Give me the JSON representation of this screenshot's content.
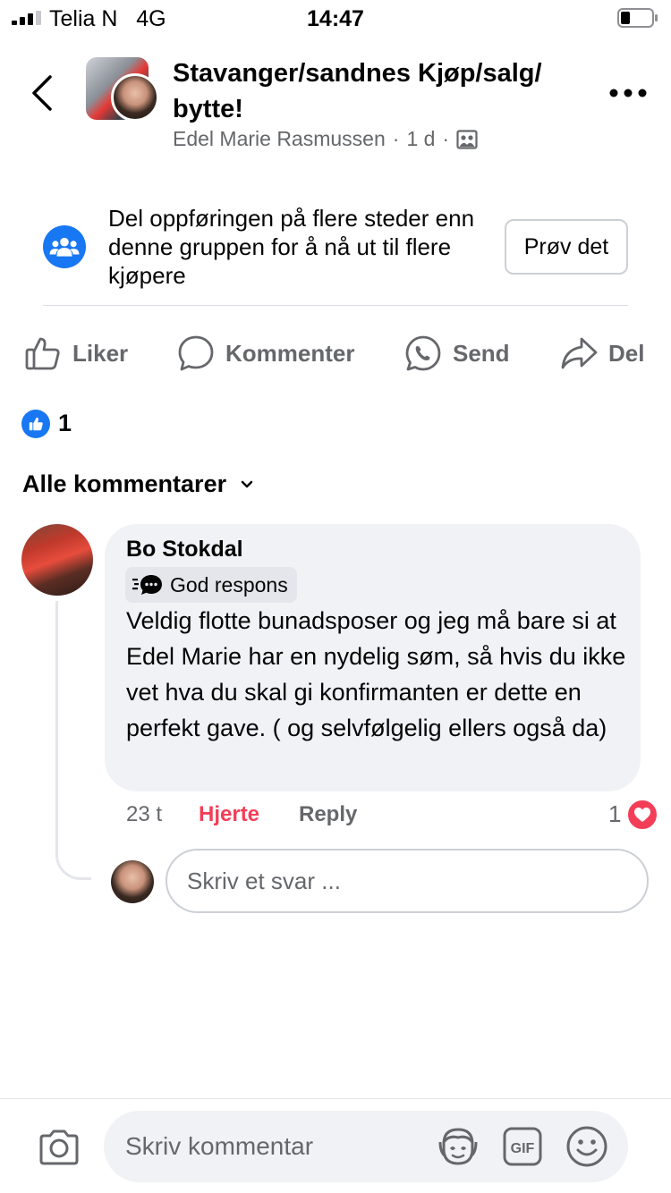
{
  "status_bar": {
    "carrier": "Telia N",
    "network": "4G",
    "time": "14:47",
    "signal_bars_filled": 3,
    "signal_bars_total": 4
  },
  "header": {
    "group_title": "Stavanger/sandnes Kjøp/salg/ bytte!",
    "author_name": "Edel Marie Rasmussen",
    "separator": "·",
    "post_age": "1 d",
    "audience_icon": "group-members-icon",
    "back_icon": "chevron-left-icon",
    "more_icon": "more-dots-icon"
  },
  "share_prompt": {
    "icon": "group-people-icon",
    "text": "Del oppføringen på flere steder enn denne gruppen for å nå ut til flere kjøpere",
    "button_label": "Prøv det"
  },
  "actions": {
    "like": {
      "label": "Liker",
      "icon": "thumbs-up-outline-icon"
    },
    "comment": {
      "label": "Kommenter",
      "icon": "comment-bubble-icon"
    },
    "send": {
      "label": "Send",
      "icon": "whatsapp-icon"
    },
    "share": {
      "label": "Del",
      "icon": "share-arrow-icon"
    }
  },
  "reactions": {
    "icon": "like-reaction-icon",
    "count": "1"
  },
  "comments_filter": {
    "label": "Alle kommentarer",
    "icon": "chevron-down-icon"
  },
  "comment": {
    "author": "Bo Stokdal",
    "badge": {
      "label": "God respons",
      "icon": "fast-responder-icon"
    },
    "text": "Veldig flotte bunadsposer og jeg må bare si at Edel Marie har en nydelig søm, så hvis du ikke vet hva du skal gi konfirmanten er dette en perfekt gave. ( og selvfølgelig ellers også da)",
    "time": "23 t",
    "reaction_label": "Hjerte",
    "reply_label": "Reply",
    "reaction_count": "1",
    "reaction_icon": "heart-reaction-icon"
  },
  "reply": {
    "placeholder": "Skriv et svar ..."
  },
  "composer": {
    "placeholder": "Skriv kommentar",
    "camera_icon": "camera-icon",
    "avatar_sticker_icon": "avatar-sticker-icon",
    "gif_icon": "gif-icon",
    "emoji_icon": "emoji-icon"
  },
  "colors": {
    "brand_blue": "#1877f2",
    "heart_red": "#f33e58",
    "secondary_text": "#65676b",
    "bubble_gray": "#f0f2f5"
  }
}
